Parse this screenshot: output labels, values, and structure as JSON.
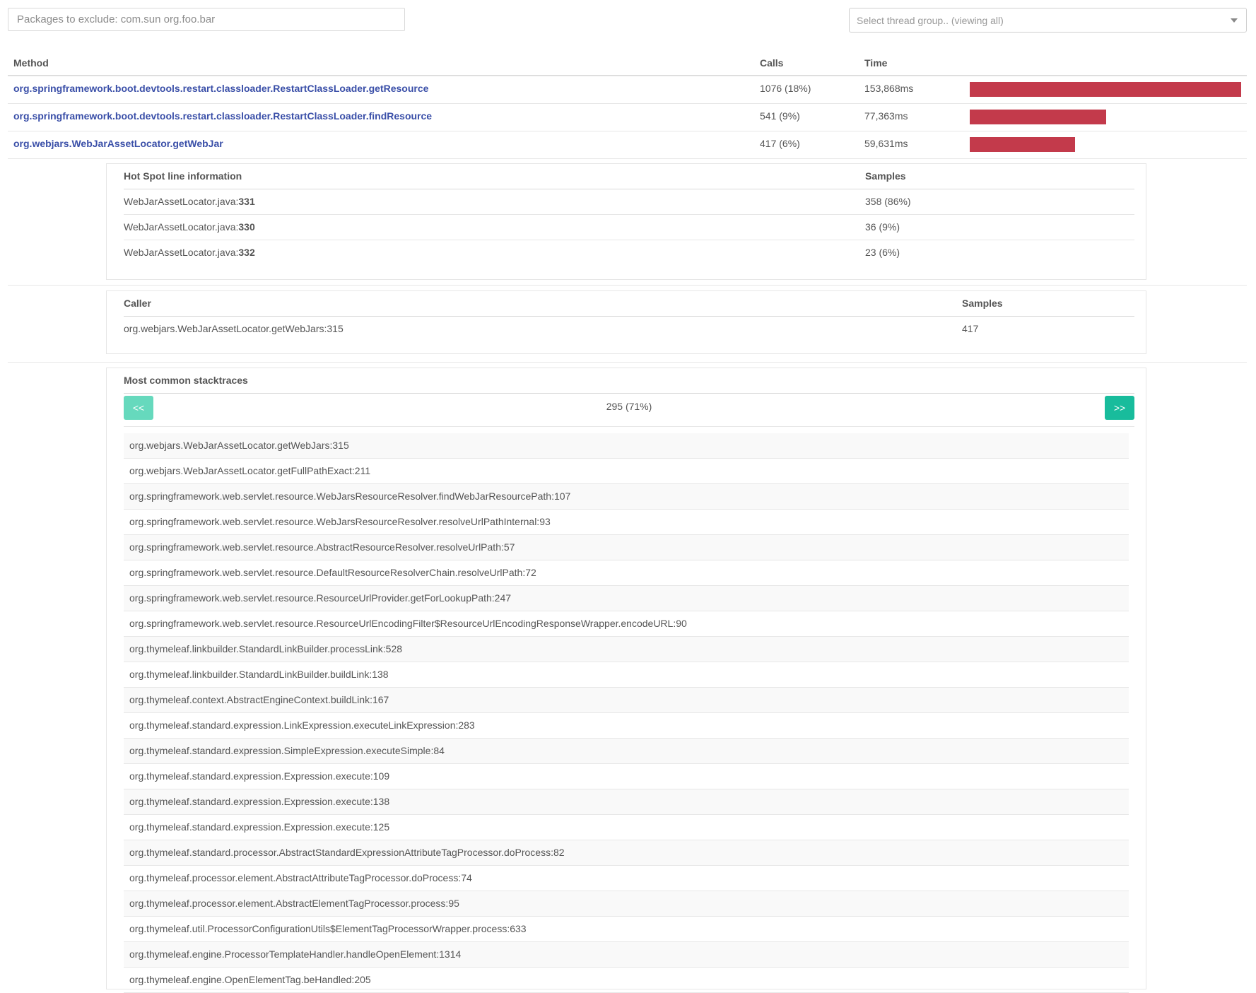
{
  "filters": {
    "exclude_placeholder": "Packages to exclude: com.sun org.foo.bar",
    "thread_group_label": "Select thread group.. (viewing all)"
  },
  "methods": {
    "headers": {
      "method": "Method",
      "calls": "Calls",
      "time": "Time"
    },
    "rows": [
      {
        "method": "org.springframework.boot.devtools.restart.classloader.RestartClassLoader.getResource",
        "calls": "1076 (18%)",
        "time": "153,868ms",
        "time_fraction": 1.0
      },
      {
        "method": "org.springframework.boot.devtools.restart.classloader.RestartClassLoader.findResource",
        "calls": "541 (9%)",
        "time": "77,363ms",
        "time_fraction": 0.503
      },
      {
        "method": "org.webjars.WebJarAssetLocator.getWebJar",
        "calls": "417 (6%)",
        "time": "59,631ms",
        "time_fraction": 0.388
      }
    ],
    "bar_color": "#c33a4b",
    "link_color": "#3a4fa8"
  },
  "hotspot": {
    "headers": {
      "line_info": "Hot Spot line information",
      "samples": "Samples"
    },
    "rows": [
      {
        "file": "WebJarAssetLocator.java:",
        "line": "331",
        "samples": "358 (86%)"
      },
      {
        "file": "WebJarAssetLocator.java:",
        "line": "330",
        "samples": "36 (9%)"
      },
      {
        "file": "WebJarAssetLocator.java:",
        "line": "332",
        "samples": "23 (6%)"
      }
    ]
  },
  "callers": {
    "headers": {
      "caller": "Caller",
      "samples": "Samples"
    },
    "rows": [
      {
        "caller": "org.webjars.WebJarAssetLocator.getWebJars:315",
        "samples": "417"
      }
    ]
  },
  "stacktraces": {
    "title": "Most common stacktraces",
    "prev_label": "<<",
    "next_label": ">>",
    "current": "295 (71%)",
    "frames": [
      "org.webjars.WebJarAssetLocator.getWebJars:315",
      "org.webjars.WebJarAssetLocator.getFullPathExact:211",
      "org.springframework.web.servlet.resource.WebJarsResourceResolver.findWebJarResourcePath:107",
      "org.springframework.web.servlet.resource.WebJarsResourceResolver.resolveUrlPathInternal:93",
      "org.springframework.web.servlet.resource.AbstractResourceResolver.resolveUrlPath:57",
      "org.springframework.web.servlet.resource.DefaultResourceResolverChain.resolveUrlPath:72",
      "org.springframework.web.servlet.resource.ResourceUrlProvider.getForLookupPath:247",
      "org.springframework.web.servlet.resource.ResourceUrlEncodingFilter$ResourceUrlEncodingResponseWrapper.encodeURL:90",
      "org.thymeleaf.linkbuilder.StandardLinkBuilder.processLink:528",
      "org.thymeleaf.linkbuilder.StandardLinkBuilder.buildLink:138",
      "org.thymeleaf.context.AbstractEngineContext.buildLink:167",
      "org.thymeleaf.standard.expression.LinkExpression.executeLinkExpression:283",
      "org.thymeleaf.standard.expression.SimpleExpression.executeSimple:84",
      "org.thymeleaf.standard.expression.Expression.execute:109",
      "org.thymeleaf.standard.expression.Expression.execute:138",
      "org.thymeleaf.standard.expression.Expression.execute:125",
      "org.thymeleaf.standard.processor.AbstractStandardExpressionAttributeTagProcessor.doProcess:82",
      "org.thymeleaf.processor.element.AbstractAttributeTagProcessor.doProcess:74",
      "org.thymeleaf.processor.element.AbstractElementTagProcessor.process:95",
      "org.thymeleaf.util.ProcessorConfigurationUtils$ElementTagProcessorWrapper.process:633",
      "org.thymeleaf.engine.ProcessorTemplateHandler.handleOpenElement:1314",
      "org.thymeleaf.engine.OpenElementTag.beHandled:205"
    ]
  }
}
